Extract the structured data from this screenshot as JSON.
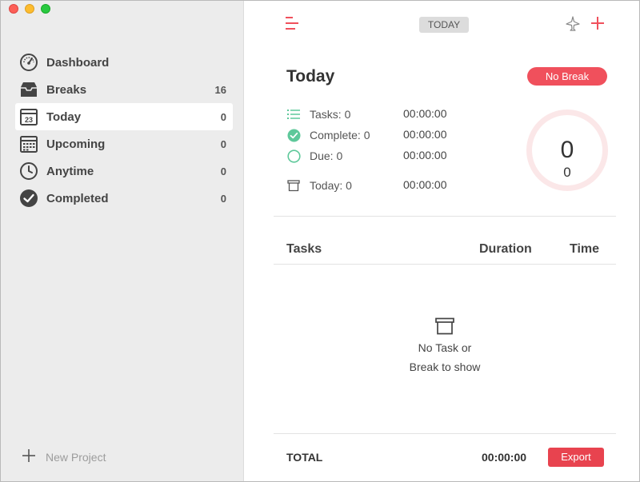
{
  "sidebar": {
    "items": [
      {
        "label": "Dashboard",
        "count": "",
        "icon": "dashboard-gauge-icon"
      },
      {
        "label": "Breaks",
        "count": "16",
        "icon": "inbox-tray-icon"
      },
      {
        "label": "Today",
        "count": "0",
        "icon": "calendar-day-icon",
        "day": "23"
      },
      {
        "label": "Upcoming",
        "count": "0",
        "icon": "calendar-grid-icon"
      },
      {
        "label": "Anytime",
        "count": "0",
        "icon": "clock-icon"
      },
      {
        "label": "Completed",
        "count": "0",
        "icon": "check-circle-icon"
      }
    ],
    "new_project_label": "New Project"
  },
  "toolbar": {
    "view_label": "TODAY"
  },
  "summary": {
    "title": "Today",
    "no_break_label": "No Break",
    "stats": [
      {
        "label": "Tasks: 0",
        "time": "00:00:00",
        "icon": "list-icon"
      },
      {
        "label": "Complete: 0",
        "time": "00:00:00",
        "icon": "check-circle-green-icon"
      },
      {
        "label": "Due: 0",
        "time": "00:00:00",
        "icon": "circle-outline-icon"
      },
      {
        "label": "Today: 0",
        "time": "00:00:00",
        "icon": "archive-box-icon"
      }
    ],
    "ring_big": "0",
    "ring_small": "0"
  },
  "table": {
    "headers": [
      "Tasks",
      "Duration",
      "Time"
    ],
    "empty_line1": "No Task or",
    "empty_line2": "Break to show"
  },
  "footer": {
    "total_label": "TOTAL",
    "total_time": "00:00:00",
    "export_label": "Export"
  },
  "colors": {
    "accent": "#f0505c",
    "sidebar_bg": "#ececec",
    "complete_green": "#5ec89a"
  }
}
